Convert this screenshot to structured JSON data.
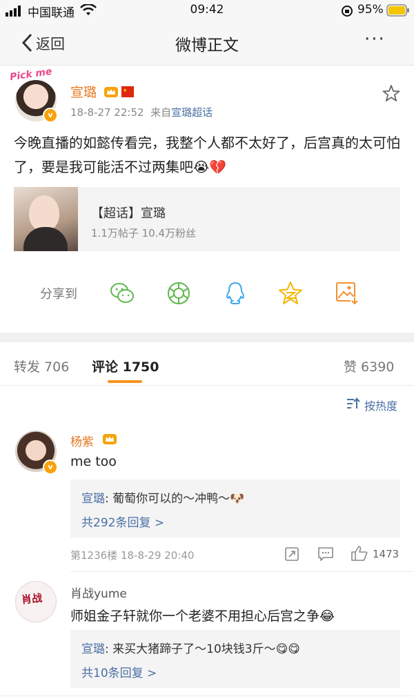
{
  "status": {
    "carrier": "中国联通",
    "time": "09:42",
    "battery": "95%"
  },
  "nav": {
    "back_label": "返回",
    "title": "微博正文",
    "more": "···"
  },
  "post": {
    "author": "宣璐",
    "timestamp": "18-8-27 22:52",
    "source_prefix": "来自",
    "source": "宣璐超话",
    "text": "今晚直播的如懿传看完，我整个人都不太好了，后宫真的太可怕了，要是我可能活不过两集吧😭💔",
    "avatar_sticker": "Pick me",
    "topic": {
      "title": "【超话】宣璐",
      "stats": "1.1万帖子 10.4万粉丝"
    },
    "share_label": "分享到"
  },
  "tabs": {
    "repost": "转发 706",
    "comments": "评论 1750",
    "likes": "赞 6390"
  },
  "sort_label": "按热度",
  "comments": [
    {
      "name": "杨紫",
      "text": "me too",
      "reply_user": "宣璐",
      "reply_text": ": 葡萄你可以的～冲鸭～🐶",
      "reply_more": "共292条回复 >",
      "meta": "第1236楼 18-8-29 20:40",
      "likes": "1473"
    },
    {
      "name": "肖战yume",
      "text": "师姐金子轩就你一个老婆不用担心后宫之争😂",
      "reply_user": "宣璐",
      "reply_text": ": 来买大猪蹄子了～10块钱3斤～😋😋",
      "reply_more": "共10条回复 >",
      "avatar_text": "肖战"
    }
  ],
  "colors": {
    "accent_orange": "#e8761b",
    "link_blue": "#4a6fa5",
    "tab_underline": "#f7931e",
    "badge_gold": "#f7a20a"
  }
}
